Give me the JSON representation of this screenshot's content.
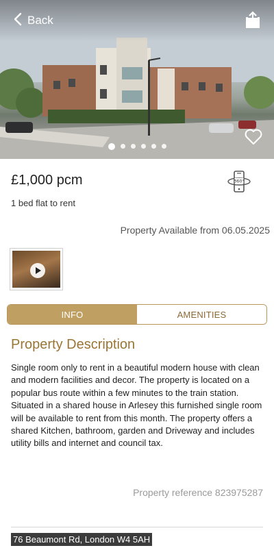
{
  "header": {
    "back_label": "Back",
    "gallery_dot_count": 6,
    "gallery_active_index": 0
  },
  "listing": {
    "price": "£1,000 pcm",
    "subtitle": "1 bed flat to rent",
    "availability": "Property Available from 06.05.2025"
  },
  "tabs": [
    {
      "label": "INFO",
      "active": true
    },
    {
      "label": "AMENITIES",
      "active": false
    }
  ],
  "description": {
    "title": "Property Description",
    "body": "Single room only to rent in a beautiful modern house with clean and modern facilities and decor. The property is located on a popular bus route within a few minutes to the train station. Situated in a shared house in Arlesey this furnished single room will be available to rent from this month. The property offers a shared Kitchen, bathroom, garden and Driveway and includes utility bills and internet and council tax."
  },
  "reference": "Property reference 823975287",
  "address": "76 Beaumont Rd, London W4 5AH",
  "colors": {
    "accent": "#c0a062",
    "accent_text": "#9a7535"
  },
  "icons": {
    "back": "chevron-left-icon",
    "share": "share-icon",
    "favourite": "heart-icon",
    "vr": "vr-360-phone-icon",
    "play": "play-icon"
  }
}
